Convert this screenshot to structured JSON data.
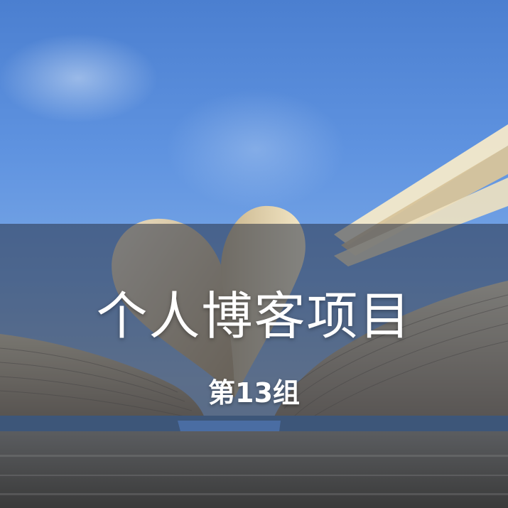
{
  "cover": {
    "title": "个人博客项目",
    "subtitle": "第13组"
  },
  "image": {
    "subject": "open-book-heart-pages-icon"
  },
  "colors": {
    "sky_top": "#4b7fd0",
    "sky_bottom": "#8ea7c8",
    "overlay": "#28324659",
    "text": "#ffffff"
  }
}
